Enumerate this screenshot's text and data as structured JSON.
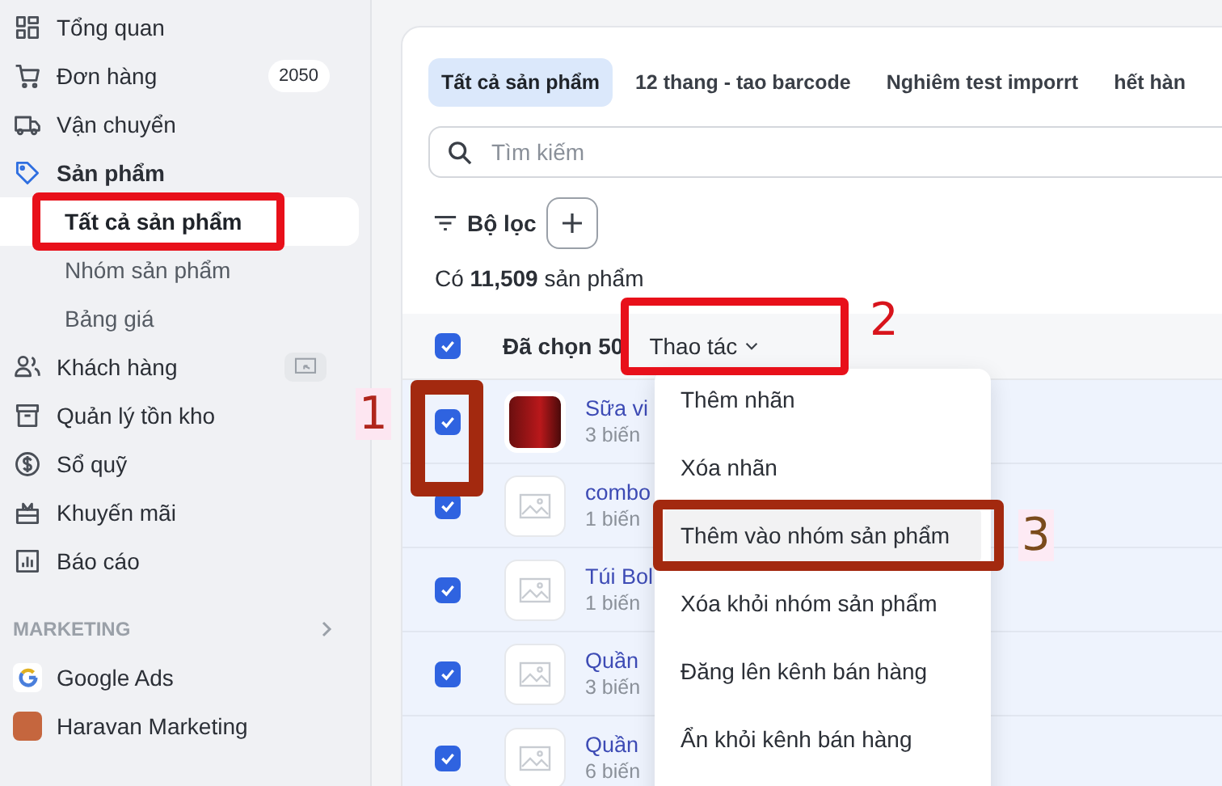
{
  "sidebar": {
    "items": [
      {
        "label": "Tổng quan",
        "shortcut": false,
        "expanded": false
      },
      {
        "label": "Đơn hàng",
        "badge": "2050",
        "shortcut": false,
        "expanded": false
      },
      {
        "label": "Vận chuyển",
        "shortcut": false,
        "expanded": false
      },
      {
        "label": "Sản phẩm",
        "shortcut": false,
        "expanded": true,
        "children": [
          {
            "label": "Tất cả sản phẩm",
            "selected": true
          },
          {
            "label": "Nhóm sản phẩm",
            "selected": false
          },
          {
            "label": "Bảng giá",
            "selected": false
          }
        ]
      },
      {
        "label": "Khách hàng",
        "shortcut": true,
        "expanded": false
      },
      {
        "label": "Quản lý tồn kho",
        "shortcut": false,
        "expanded": false
      },
      {
        "label": "Sổ quỹ",
        "shortcut": false,
        "expanded": false
      },
      {
        "label": "Khuyến mãi",
        "shortcut": false,
        "expanded": false
      },
      {
        "label": "Báo cáo",
        "shortcut": false,
        "expanded": false
      }
    ],
    "marketing": {
      "title": "MARKETING",
      "items": [
        {
          "label": "Google Ads"
        },
        {
          "label": "Haravan Marketing"
        }
      ]
    }
  },
  "tabs": [
    {
      "label": "Tất cả sản phẩm",
      "selected": true
    },
    {
      "label": "12 thang - tao barcode",
      "selected": false
    },
    {
      "label": "Nghiêm test imporrt",
      "selected": false
    },
    {
      "label": "hết hàn",
      "selected": false
    }
  ],
  "search": {
    "placeholder": "Tìm kiếm"
  },
  "filter": {
    "label": "Bộ lọc"
  },
  "count": "Có **11,509** sản phẩm",
  "bulk_bar": {
    "checked": true,
    "selected_text": "Đã chọn 50",
    "actions_label": "Thao tác"
  },
  "rows": [
    {
      "name": "Sữa vi",
      "variants": "3 biến",
      "checked": true,
      "photo": true
    },
    {
      "name": "combo",
      "variants": "1 biến",
      "checked": true,
      "photo": false
    },
    {
      "name": "Túi Bol",
      "variants": "1 biến",
      "checked": true,
      "photo": false
    },
    {
      "name": "Quần",
      "variants": "3 biến",
      "checked": true,
      "photo": false
    },
    {
      "name": "Quần",
      "variants": "6 biến",
      "checked": true,
      "photo": false
    }
  ],
  "actions_menu": [
    {
      "label": "Thêm nhãn",
      "selected": false
    },
    {
      "label": "Xóa nhãn",
      "selected": false
    },
    {
      "label": "Thêm vào nhóm sản phẩm",
      "selected": true
    },
    {
      "label": "Xóa khỏi nhóm sản phẩm",
      "selected": false
    },
    {
      "label": "Đăng lên kênh bán hàng",
      "selected": false
    },
    {
      "label": "Ẩn khỏi kênh bán hàng",
      "selected": false
    }
  ],
  "annotations": [
    {
      "label": "1",
      "color": "#b0261c"
    },
    {
      "label": "2",
      "color": "#d8141c"
    },
    {
      "label": "3",
      "color": "#7a4b1c"
    }
  ]
}
